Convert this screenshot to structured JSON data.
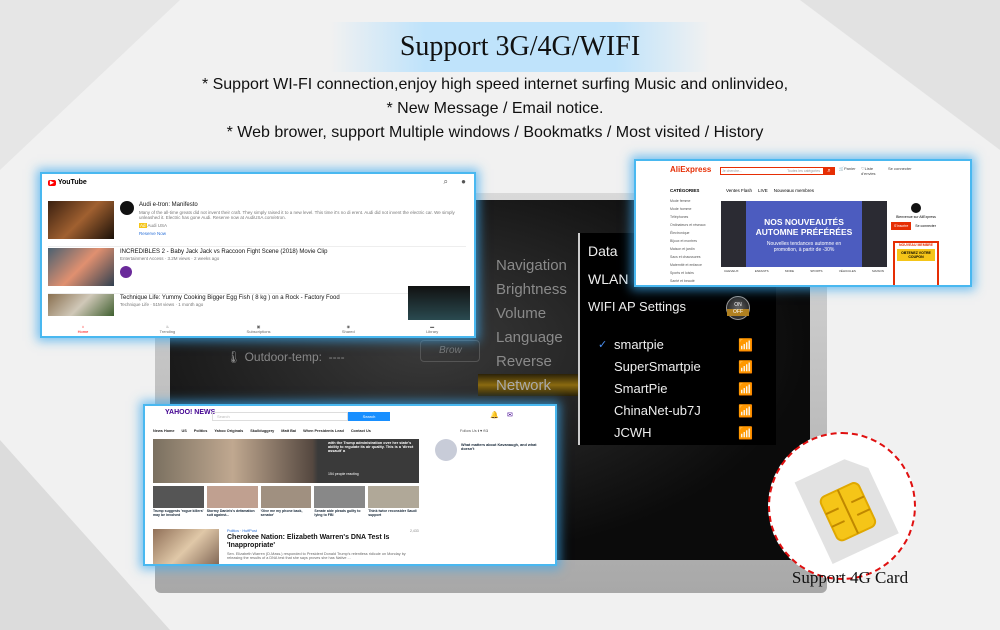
{
  "header": {
    "title": "Support 3G/4G/WIFI",
    "bullets": [
      "* Support WI-FI connection,enjoy high speed internet surfing Music and onlinvideo,",
      "* New Message / Email notice.",
      "* Web brower, support Multiple windows / Bookmatks / Most visited / History"
    ]
  },
  "settings": {
    "menu": [
      "Navigation",
      "Brightness",
      "Volume",
      "Language",
      "Reverse",
      "Network"
    ],
    "selected": "Network",
    "outdoor_label": "Outdoor-temp:",
    "outdoor_value": "----",
    "browser_label": "Brow",
    "panel": {
      "data": "Data",
      "wlan": "WLAN",
      "ap": "WIFI AP Settings",
      "toggle_on": "ON",
      "toggle_off": "OFF",
      "networks": [
        {
          "name": "smartpie",
          "connected": true
        },
        {
          "name": "SuperSmartpie",
          "connected": false
        },
        {
          "name": "SmartPie",
          "connected": false
        },
        {
          "name": "ChinaNet-ub7J",
          "connected": false
        },
        {
          "name": "JCWH",
          "connected": false
        }
      ]
    }
  },
  "youtube": {
    "logo": "YouTube",
    "videos": [
      {
        "title": "Audi e-tron: Manifesto",
        "desc": "Many of the all-time greats did not invent their craft. They simply raised it to a new level. This time it's no di erent. Audi did not invent the electric car. We simply unleashed it. Electric has gone Audi. Reserve now at AudiUSA.com/etron.",
        "badge": "Ad",
        "channel": "Audi USA",
        "link": "Reserve Now"
      },
      {
        "title": "INCREDIBLES 2 - Baby Jack Jack vs Raccoon Fight Scene (2018) Movie Clip",
        "meta": "Entertainment Access · 3.2M views · 2 weeks ago",
        "duration": "2:26"
      },
      {
        "title": "Technique Life: Yummy Cooking Bigger Egg Fish ( 8 kg ) on a Rock - Factory Food",
        "meta": "Technique Life · 51M views · 1 month ago"
      }
    ],
    "nav": [
      "Home",
      "Trending",
      "Subscriptions",
      "Shared",
      "Library"
    ]
  },
  "aliexpress": {
    "logo": "AliExpress",
    "search_placeholder": "Je cherche...",
    "category_select": "Toutes les catégories",
    "cart": "Panier",
    "wishlist": "Liste d'envies",
    "account": "Se connecter",
    "tabs": [
      "Ventes Flash",
      "LIVE",
      "Nouveaux membres"
    ],
    "categories_label": "CATÉGORIES",
    "categories": [
      "Mode femme",
      "Mode homme",
      "Téléphones",
      "Ordinateurs et réseaux",
      "Électronique",
      "Bijoux et montres",
      "Maison et jardin",
      "Sacs et chaussures",
      "Maternité et enfance",
      "Sports et loisirs",
      "Santé et beauté"
    ],
    "banner_title": "NOS NOUVEAUTÉS AUTOMNE PRÉFÉRÉES",
    "banner_sub": "Nouvelles tendances automne en promotion, à partir de -30%",
    "welcome": "Bienvenue sur AliExpress",
    "register": "S'inscrire",
    "login": "Se connecter",
    "promo_head": "NOUVEAU MEMBRE",
    "coupon": "OBTENEZ VOTRE COUPON",
    "strip": [
      "CHEVEUX",
      "ENFANTS",
      "MODE",
      "SPORTS",
      "VÉHICULES",
      "MAISON"
    ]
  },
  "yahoo": {
    "logo": "YAHOO! NEWS",
    "search_placeholder": "Search",
    "search_button": "Search",
    "nav": [
      "News Home",
      "US",
      "Politics",
      "Yahoo Originals",
      "Skullduggery",
      "Matt Bai",
      "When Presidents Lead",
      "Contact Us"
    ],
    "follow": "Follow Us",
    "hero_text": "with the Trump administration over her state's ability to regulate its air quality. This is a 'direct assault' a",
    "reacting": "154 people reacting",
    "side_story": "What matters about Kavanaugh, and what doesn't",
    "thumbs": [
      "Trump suggests 'rogue killers' may be involved",
      "Stormy Daniels's defamation suit against...",
      "'Give me my phone back, senator'",
      "Senate aide pleads guilty to lying to FBI",
      "Think twice reconsider Saudi support"
    ],
    "story_source": "Politics · HuffPost",
    "story_title": "Cherokee Nation: Elizabeth Warren's DNA Test Is 'Inappropriate'",
    "story_desc": "Sen. Elizabeth Warren (D-Mass.) responded to President Donald Trump's relentless ridicule on Monday by releasing the results of a DNA test that she says proves she has Native ...",
    "comments": "2,433"
  },
  "sim": {
    "caption": "Support 4G Card"
  },
  "colors": {
    "glow": "#49b8f0",
    "sim_border": "#e01010",
    "chip": "#f5c518",
    "yt_red": "#ff0000",
    "ali_red": "#e62e04",
    "yahoo_purple": "#400090",
    "yahoo_blue": "#188fff"
  }
}
